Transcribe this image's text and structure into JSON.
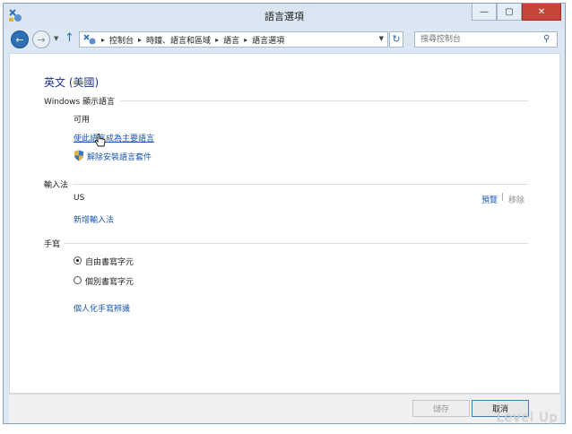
{
  "window": {
    "title": "語言選項"
  },
  "window_buttons": {
    "minimize": "—",
    "maximize": "▢",
    "close": "✕"
  },
  "nav": {
    "back_glyph": "←",
    "forward_glyph": "→",
    "dropdown_glyph": "▼",
    "up_glyph": "↑",
    "breadcrumb": [
      "控制台",
      "時鐘、語言和區域",
      "語言",
      "語言選項"
    ],
    "breadcrumb_sep": "▸",
    "refresh_glyph": "↻",
    "search_placeholder": "搜尋控制台",
    "search_glyph": "⚲"
  },
  "main": {
    "heading": "英文 (美國)",
    "display_language": {
      "title": "Windows 顯示語言",
      "status": "可用",
      "set_primary_link": "使此語言成為主要語言",
      "uninstall_link": "解除安裝語言套件"
    },
    "input_method": {
      "title": "輸入法",
      "item": "US",
      "preview_link": "預覽",
      "divider": "|",
      "remove_link": "移除",
      "add_link": "新增輸入法"
    },
    "handwriting": {
      "title": "手寫",
      "options": [
        {
          "label": "自由書寫字元",
          "selected": true
        },
        {
          "label": "個別書寫字元",
          "selected": false
        }
      ],
      "personalize_link": "個人化手寫辨識"
    }
  },
  "footer": {
    "save_label": "儲存",
    "cancel_label": "取消"
  },
  "watermark": "Level Up",
  "colors": {
    "link": "#1a56b0",
    "heading": "#1e3287",
    "accent": "#2d6fb6",
    "close": "#c7443a"
  }
}
